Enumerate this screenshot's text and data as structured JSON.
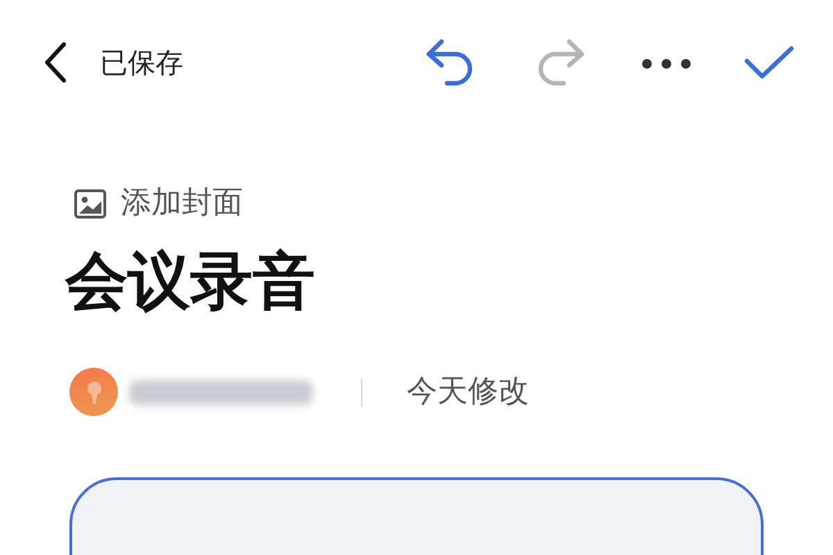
{
  "top_bar": {
    "status": "已保存",
    "undo": {
      "disabled": false
    },
    "redo": {
      "disabled": true
    }
  },
  "cover": {
    "label": "添加封面"
  },
  "title": "会议录音",
  "meta": {
    "author_blurred": true,
    "modified": "今天修改"
  },
  "content_box": {
    "focused": true
  }
}
